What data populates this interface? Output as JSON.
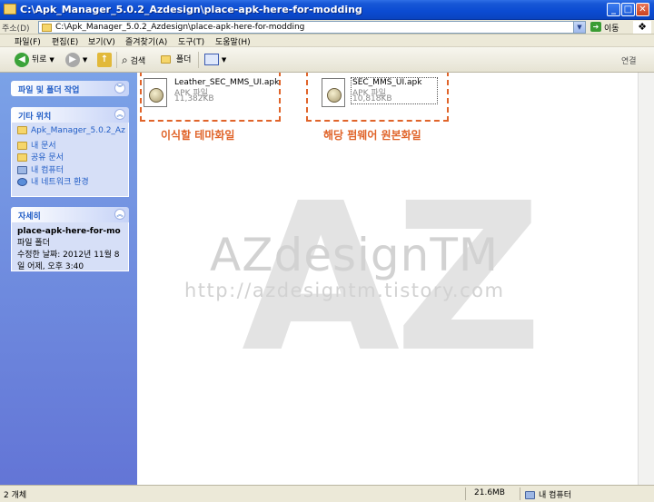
{
  "window": {
    "title": "C:\\Apk_Manager_5.0.2_Azdesign\\place-apk-here-for-modding",
    "minimize_glyph": "_",
    "maximize_glyph": "□",
    "close_glyph": "✕"
  },
  "address": {
    "label": "주소(D)",
    "path": "C:\\Apk_Manager_5.0.2_Azdesign\\place-apk-here-for-modding",
    "go_label": "이동"
  },
  "menu": [
    "파일(F)",
    "편집(E)",
    "보기(V)",
    "즐겨찾기(A)",
    "도구(T)",
    "도움말(H)"
  ],
  "toolbar": {
    "back_label": "뒤로",
    "search_label": "검색",
    "folders_label": "폴더",
    "links_label": "연결"
  },
  "sidebar": {
    "tasks_title": "파일 및 폴더 작업",
    "places_title": "기타 위치",
    "places": [
      {
        "label": "Apk_Manager_5.0.2_Az",
        "icon": "folder-icon"
      },
      {
        "label": "내 문서",
        "icon": "my-documents-icon"
      },
      {
        "label": "공유 문서",
        "icon": "shared-documents-icon"
      },
      {
        "label": "내 컴퓨터",
        "icon": "my-computer-icon"
      },
      {
        "label": "내 네트워크 환경",
        "icon": "network-places-icon"
      }
    ],
    "details_title": "자세히",
    "details": {
      "name": "place-apk-here-for-mo",
      "type": "파일 폴더",
      "modified_line1": "수정한 날짜: 2012년 11월 8",
      "modified_line2": "일 어제, 오후 3:40"
    }
  },
  "files": [
    {
      "name": "Leather_SEC_MMS_UI.apk",
      "type": "APK 파일",
      "size": "11,382KB",
      "selected": false
    },
    {
      "name": "SEC_MMS_UI.apk",
      "type": "APK 파일",
      "size": "10,818KB",
      "selected": true
    }
  ],
  "annotations": {
    "left": "이식할 테마화일",
    "right": "해당 펌웨어 원본화일"
  },
  "watermark": {
    "big": "AZ",
    "brand": "AZdesignTM",
    "url": "http://azdesigntm.tistory.com"
  },
  "status": {
    "count": "2 개체",
    "size": "21.6MB",
    "location": "내 컴퓨터"
  },
  "colors": {
    "titlebar": "#0b4bd2",
    "sidebar": "#6f8fe0",
    "annotation": "#e0642a"
  }
}
